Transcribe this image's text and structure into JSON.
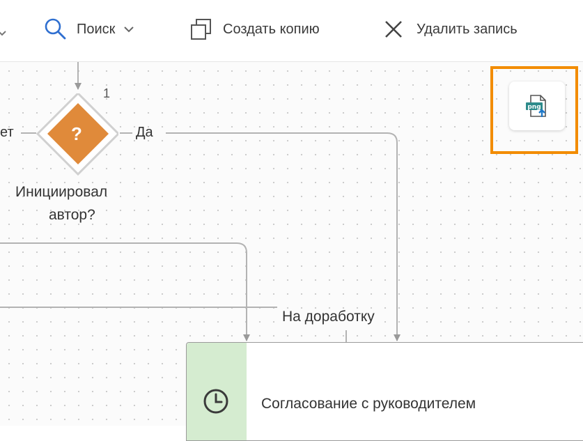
{
  "toolbar": {
    "search_label": "Поиск",
    "copy_label": "Создать копию",
    "delete_label": "Удалить запись"
  },
  "diagram": {
    "gateway_number": "1",
    "gateway_symbol": "?",
    "branch_no_label": "ет",
    "branch_yes_label": "Да",
    "gateway_title_line1": "Инициировал",
    "gateway_title_line2": "автор?",
    "rework_label": "На доработку",
    "task_title": "Согласование с руководителем"
  },
  "export_button": {
    "icon_text": "png"
  },
  "colors": {
    "accent_highlight": "#f28c00",
    "gateway_fill": "#e08a3a",
    "task_band": "#d5ecd0",
    "icon_teal": "#2e8b8b",
    "icon_blue": "#1e78c8"
  }
}
